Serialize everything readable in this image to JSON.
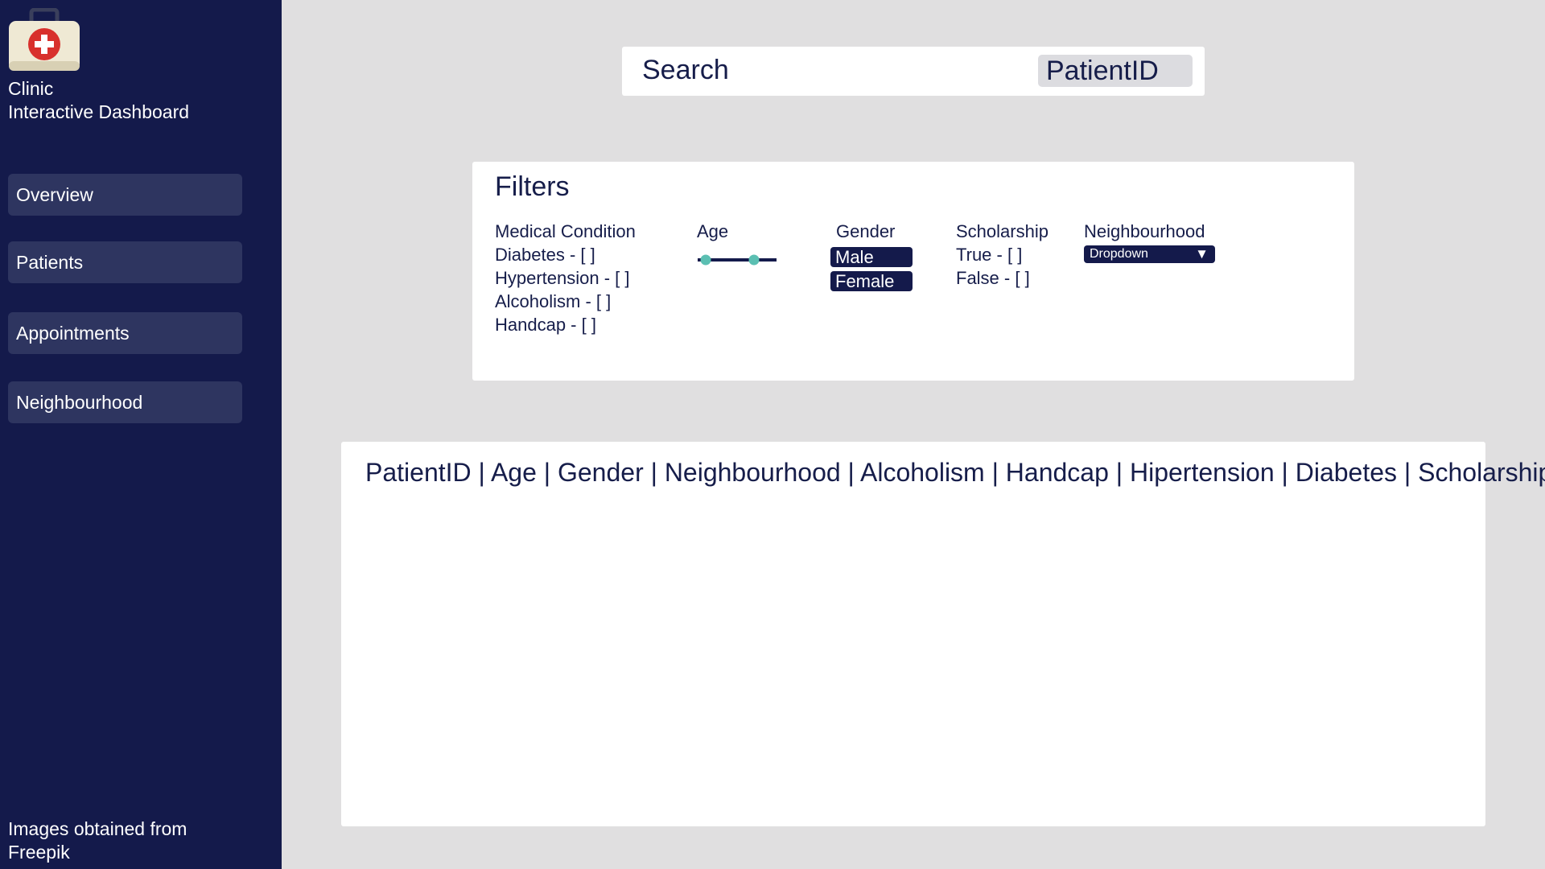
{
  "brand": {
    "title": "Clinic",
    "subtitle": "Interactive Dashboard",
    "logo_icon": "medical-kit-icon"
  },
  "sidebar": {
    "items": [
      {
        "label": "Overview"
      },
      {
        "label": "Patients"
      },
      {
        "label": "Appointments"
      },
      {
        "label": "Neighbourhood"
      }
    ],
    "credit_line1": "Images obtained from",
    "credit_line2": "Freepik"
  },
  "search": {
    "label": "Search",
    "placeholder": "PatientID"
  },
  "filters": {
    "title": "Filters",
    "medical_condition": {
      "label": "Medical Condition",
      "options": [
        "Diabetes - [ ]",
        "Hypertension - [ ]",
        "Alcoholism - [ ]",
        "Handcap - [ ]"
      ]
    },
    "age": {
      "label": "Age"
    },
    "gender": {
      "label": "Gender",
      "options": [
        "Male",
        "Female"
      ]
    },
    "scholarship": {
      "label": "Scholarship",
      "options": [
        "True - [ ]",
        "False - [ ]"
      ]
    },
    "neighbourhood": {
      "label": "Neighbourhood",
      "dropdown": "Dropdown",
      "arrow": "▼"
    }
  },
  "table": {
    "header": "PatientID | Age | Gender | Neighbourhood | Alcoholism | Handcap | Hipertension | Diabetes | Scholarship"
  },
  "colors": {
    "sidebar": "#141a4b",
    "nav_item": "#2e3560",
    "background": "#e0dfe0",
    "accent": "#5bbfb2",
    "logo_red": "#d8302c"
  }
}
